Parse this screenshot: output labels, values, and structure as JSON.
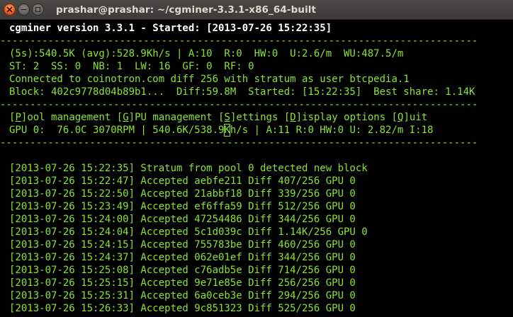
{
  "window": {
    "title": "prashar@prashar: ~/cgminer-3.3.1-x86_64-built",
    "buttons": [
      "close-icon",
      "minimize-icon",
      "maximize-icon"
    ]
  },
  "terminal": {
    "header": "cgminer version 3.3.1 - Started: [2013-07-26 15:22:35]",
    "separator": "--------------------------------------------------------------------------------",
    "stats": [
      "(5s):540.5K (avg):528.9Kh/s | A:10  R:0  HW:0  U:2.6/m  WU:487.5/m",
      "ST: 2  SS: 0  NB: 1  LW: 16  GF: 0  RF: 0",
      "Connected to coinotron.com diff 256 with stratum as user btcpedia.1",
      "Block: 402c9778d04b89b1...  Diff:59.8M  Started: [15:22:35]  Best share: 1.14K"
    ],
    "menu": {
      "pool_key": "P",
      "pool_rest": "ool management ",
      "gpu_key": "G",
      "gpu_rest": "PU management ",
      "settings_key": "S",
      "settings_rest": "ettings ",
      "display_key": "D",
      "display_rest": "isplay options ",
      "quit_key": "Q",
      "quit_rest": "uit"
    },
    "gpu_line": {
      "before_cursor": "GPU 0:  76.0C 3070RPM | 540.6K/538.9",
      "cursor_char": "K",
      "after_cursor": "h/s | A:11 R:0 HW:0 U: 2.82/m I:18"
    },
    "log": [
      "[2013-07-26 15:22:35] Stratum from pool 0 detected new block",
      "[2013-07-26 15:22:47] Accepted aebfe211 Diff 407/256 GPU 0",
      "[2013-07-26 15:22:50] Accepted 21abbf18 Diff 339/256 GPU 0",
      "[2013-07-26 15:23:49] Accepted ef6ffa59 Diff 512/256 GPU 0",
      "[2013-07-26 15:24:00] Accepted 47254486 Diff 344/256 GPU 0",
      "[2013-07-26 15:24:04] Accepted 5c1d039c Diff 1.14K/256 GPU 0",
      "[2013-07-26 15:24:15] Accepted 755783be Diff 460/256 GPU 0",
      "[2013-07-26 15:24:37] Accepted 062e01ef Diff 344/256 GPU 0",
      "[2013-07-26 15:25:08] Accepted c76adb5e Diff 714/256 GPU 0",
      "[2013-07-26 15:25:15] Accepted 9e71e85e Diff 256/256 GPU 0",
      "[2013-07-26 15:25:31] Accepted 6a0ceb3e Diff 294/256 GPU 0",
      "[2013-07-26 15:26:33] Accepted 9c851323 Diff 525/256 GPU 0"
    ]
  },
  "colors": {
    "terminal_text": "#8ae234",
    "header_text": "#ffffff",
    "background": "#000000",
    "titlebar": "#3c3b37",
    "close_button": "#e25a1d"
  }
}
